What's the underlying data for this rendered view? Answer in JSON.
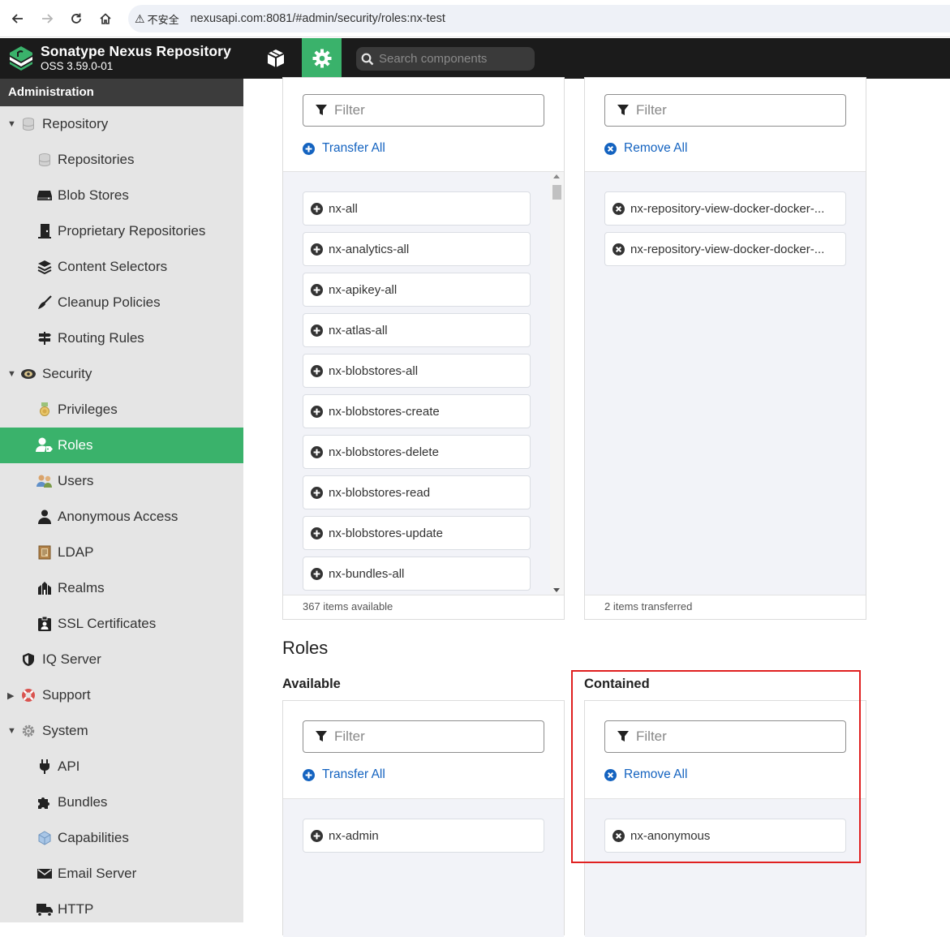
{
  "browser": {
    "security_label": "不安全",
    "url": "nexusapi.com:8081/#admin/security/roles:nx-test"
  },
  "header": {
    "title": "Sonatype Nexus Repository",
    "version": "OSS 3.59.0-01",
    "search_placeholder": "Search components"
  },
  "sidebar": {
    "heading": "Administration",
    "items": [
      {
        "label": "Repository",
        "icon": "database-icon",
        "level": 0,
        "expanded": true
      },
      {
        "label": "Repositories",
        "icon": "database-icon",
        "level": 1
      },
      {
        "label": "Blob Stores",
        "icon": "hard-drive-icon",
        "level": 1
      },
      {
        "label": "Proprietary Repositories",
        "icon": "door-icon",
        "level": 1
      },
      {
        "label": "Content Selectors",
        "icon": "layers-icon",
        "level": 1
      },
      {
        "label": "Cleanup Policies",
        "icon": "broom-icon",
        "level": 1
      },
      {
        "label": "Routing Rules",
        "icon": "signpost-icon",
        "level": 1
      },
      {
        "label": "Security",
        "icon": "badge-icon",
        "level": 0,
        "expanded": true
      },
      {
        "label": "Privileges",
        "icon": "medal-icon",
        "level": 1
      },
      {
        "label": "Roles",
        "icon": "user-tag-icon",
        "level": 1,
        "selected": true
      },
      {
        "label": "Users",
        "icon": "users-icon",
        "level": 1
      },
      {
        "label": "Anonymous Access",
        "icon": "user-icon",
        "level": 1
      },
      {
        "label": "LDAP",
        "icon": "book-icon",
        "level": 1
      },
      {
        "label": "Realms",
        "icon": "realm-icon",
        "level": 1
      },
      {
        "label": "SSL Certificates",
        "icon": "id-card-icon",
        "level": 1
      },
      {
        "label": "IQ Server",
        "icon": "shield-icon",
        "level": 0
      },
      {
        "label": "Support",
        "icon": "lifebuoy-icon",
        "level": 0,
        "collapsed": true
      },
      {
        "label": "System",
        "icon": "cog-icon",
        "level": 0,
        "expanded": true
      },
      {
        "label": "API",
        "icon": "plug-icon",
        "level": 1
      },
      {
        "label": "Bundles",
        "icon": "puzzle-icon",
        "level": 1
      },
      {
        "label": "Capabilities",
        "icon": "cube-icon",
        "level": 1
      },
      {
        "label": "Email Server",
        "icon": "envelope-icon",
        "level": 1
      },
      {
        "label": "HTTP",
        "icon": "truck-icon",
        "level": 1
      }
    ]
  },
  "privileges": {
    "available": {
      "filter_placeholder": "Filter",
      "action_label": "Transfer All",
      "items": [
        "nx-all",
        "nx-analytics-all",
        "nx-apikey-all",
        "nx-atlas-all",
        "nx-blobstores-all",
        "nx-blobstores-create",
        "nx-blobstores-delete",
        "nx-blobstores-read",
        "nx-blobstores-update",
        "nx-bundles-all"
      ],
      "footer": "367 items available"
    },
    "contained": {
      "filter_placeholder": "Filter",
      "action_label": "Remove All",
      "items": [
        "nx-repository-view-docker-docker-...",
        "nx-repository-view-docker-docker-..."
      ],
      "footer": "2 items transferred"
    }
  },
  "roles": {
    "title": "Roles",
    "available": {
      "heading": "Available",
      "filter_placeholder": "Filter",
      "action_label": "Transfer All",
      "items": [
        "nx-admin"
      ]
    },
    "contained": {
      "heading": "Contained",
      "filter_placeholder": "Filter",
      "action_label": "Remove All",
      "items": [
        "nx-anonymous"
      ]
    }
  },
  "colors": {
    "accent_green": "#3ab26b",
    "header_dark": "#1b1b1b",
    "link_blue": "#1463c0",
    "highlight_red": "#e02020"
  }
}
